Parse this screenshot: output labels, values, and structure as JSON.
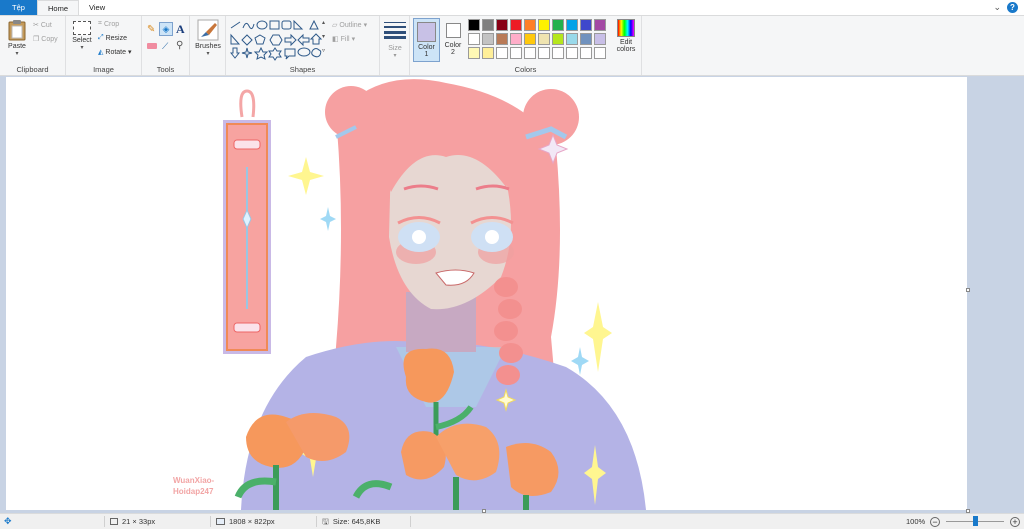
{
  "tabs": [
    {
      "label": "Tệp"
    },
    {
      "label": "Home"
    },
    {
      "label": "View"
    }
  ],
  "help_label": "?",
  "clipboard": {
    "paste": "Paste",
    "cut": "Cut",
    "copy": "Copy",
    "group": "Clipboard"
  },
  "image": {
    "select": "Select",
    "crop": "Crop",
    "resize": "Resize",
    "rotate": "Rotate",
    "group": "Image"
  },
  "tools": {
    "group": "Tools"
  },
  "brushes": {
    "label": "Brushes"
  },
  "shapes": {
    "outline": "Outline",
    "fill": "Fill",
    "group": "Shapes"
  },
  "size": {
    "label": "Size"
  },
  "colors": {
    "color1_line1": "Color",
    "color1_line2": "1",
    "color2_line1": "Color",
    "color2_line2": "2",
    "edit_line1": "Edit",
    "edit_line2": "colors",
    "group": "Colors",
    "color1": "#c8c1e6",
    "color2": "#ffffff",
    "palette_row1": [
      "#000000",
      "#7f7f7f",
      "#880015",
      "#ed1c24",
      "#ff7f27",
      "#fff200",
      "#22b14c",
      "#00a2e8",
      "#3f48cc",
      "#a349a4"
    ],
    "palette_row2": [
      "#ffffff",
      "#c3c3c3",
      "#b97a57",
      "#ffaec9",
      "#ffc90e",
      "#efe4b0",
      "#b5e61d",
      "#99d9ea",
      "#7092be",
      "#c8bfe7"
    ],
    "palette_row3": [
      "#fff9b5",
      "#ffef99",
      "#ffffff",
      "#ffffff",
      "#ffffff",
      "#ffffff",
      "#ffffff",
      "#ffffff",
      "#ffffff",
      "#ffffff"
    ]
  },
  "canvas": {
    "watermark_line1": "WuanXiao-",
    "watermark_line2": "Hoidap247"
  },
  "status": {
    "selection": "21 × 33px",
    "dimensions": "1808 × 822px",
    "size": "Size: 645,8KB",
    "zoom": "100%",
    "zoom_level": 0.5
  }
}
